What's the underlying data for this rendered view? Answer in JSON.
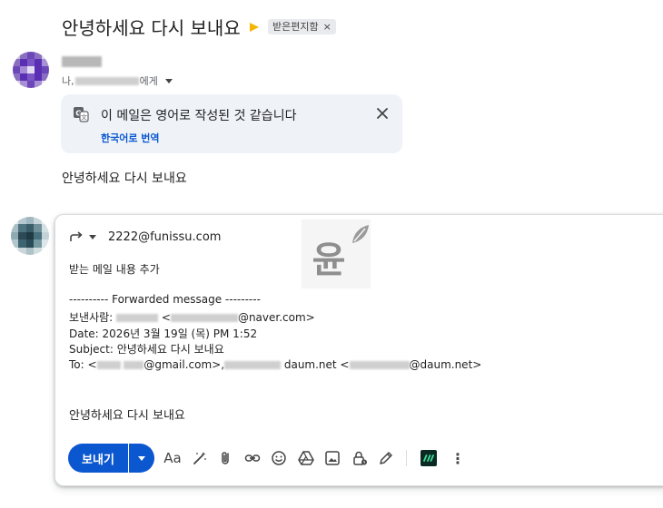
{
  "subject": "안녕하세요 다시 보내요",
  "label": {
    "name": "받은편지함",
    "close": "×"
  },
  "sender": {
    "to_me_prefix": "나,",
    "to_me_suffix": "에게"
  },
  "translate": {
    "title": "이 메일은 영어로 작성된 것 같습니다",
    "link": "한국어로 번역"
  },
  "message_body": "안녕하세요 다시 보내요",
  "compose": {
    "to": "2222@funissu.com",
    "intro": "받는 메일 내용 추가",
    "forwarded_header": "---------- Forwarded message ---------",
    "from_label": "보낸사람:",
    "from_domain": "@naver.com>",
    "date_line": "Date: 2026년 3월 19일 (목) PM 1:52",
    "subject_line": "Subject: 안녕하세요 다시 보내요",
    "to_label": "To: <",
    "to_gmail": "@gmail.com>,",
    "to_daum1": "daum.net <",
    "to_daum2": "@daum.net>",
    "lt": "<",
    "quoted_body": "안녕하세요 다시 보내요"
  },
  "toolbar": {
    "send_label": "보내기",
    "format_label": "Aa",
    "more_label": "⋮"
  },
  "watermark_char": "윤",
  "colors": {
    "accent": "#0b57d0",
    "translate_bg": "#eff3f8",
    "importance": "#f4b400"
  }
}
